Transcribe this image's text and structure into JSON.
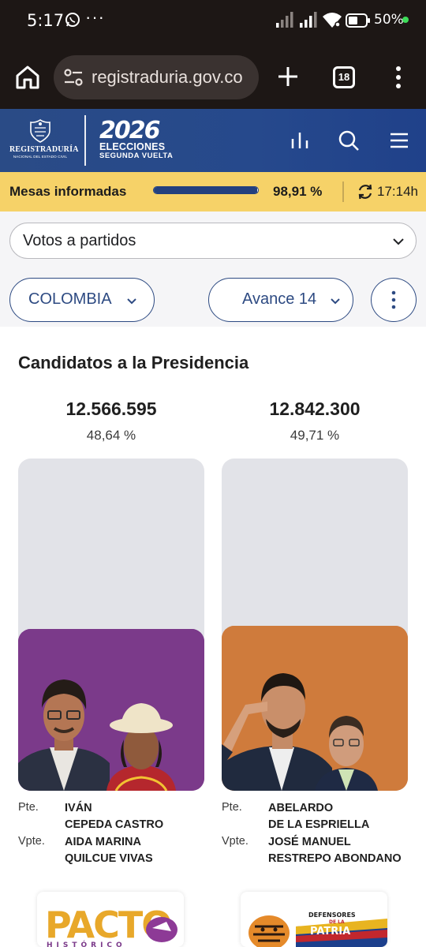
{
  "status_bar": {
    "time": "5:17",
    "more": "···",
    "battery": "50%"
  },
  "browser": {
    "url": "registraduria.gov.co",
    "tab_count": "18"
  },
  "header": {
    "org_name": "REGISTRADURÍA",
    "org_subtitle": "NACIONAL DEL ESTADO CIVIL",
    "event_year": "2026",
    "event_title": "ELECCIONES",
    "event_subtitle": "SEGUNDA VUELTA"
  },
  "progress": {
    "label": "Mesas informadas",
    "percent_text": "98,91 %",
    "fraction": 0.9891,
    "updated": "17:14h"
  },
  "filters": {
    "view_select": "Votos a partidos",
    "region": "COLOMBIA",
    "bulletin": "Avance 14"
  },
  "section_title": "Candidatos a la Presidencia",
  "candidates": [
    {
      "votes": "12.566.595",
      "percent": "48,64 %",
      "share": 0.4864,
      "photo_color": "#7b3a8a",
      "pres_role": "Pte.",
      "pres_name_1": "IVÁN",
      "pres_name_2": "CEPEDA CASTRO",
      "vice_role": "Vpte.",
      "vice_name_1": "AIDA MARINA",
      "vice_name_2": "QUILCUE VIVAS",
      "party_logo_text": "PACTO",
      "party_logo_sub": "HISTÓRICO"
    },
    {
      "votes": "12.842.300",
      "percent": "49,71 %",
      "share": 0.4971,
      "photo_color": "#cf7b3c",
      "pres_role": "Pte.",
      "pres_name_1": "ABELARDO",
      "pres_name_2": "DE LA ESPRIELLA",
      "vice_role": "Vpte.",
      "vice_name_1": "JOSÉ MANUEL",
      "vice_name_2": "RESTREPO ABONDANO",
      "party_logo_text": "DEFENSORES",
      "party_logo_mid": "DE LA",
      "party_logo_sub": "PATRIA"
    }
  ],
  "colors": {
    "brand_blue": "#26498c",
    "strip_yellow": "#f6d268",
    "purple": "#7b3a8a",
    "orange": "#cf7b3c"
  },
  "icons": [
    "home-icon",
    "site-settings-icon",
    "plus-icon",
    "tabs-icon",
    "more-vert-icon",
    "bar-chart-icon",
    "search-icon",
    "hamburger-menu-icon",
    "refresh-icon",
    "chevron-down-icon"
  ]
}
